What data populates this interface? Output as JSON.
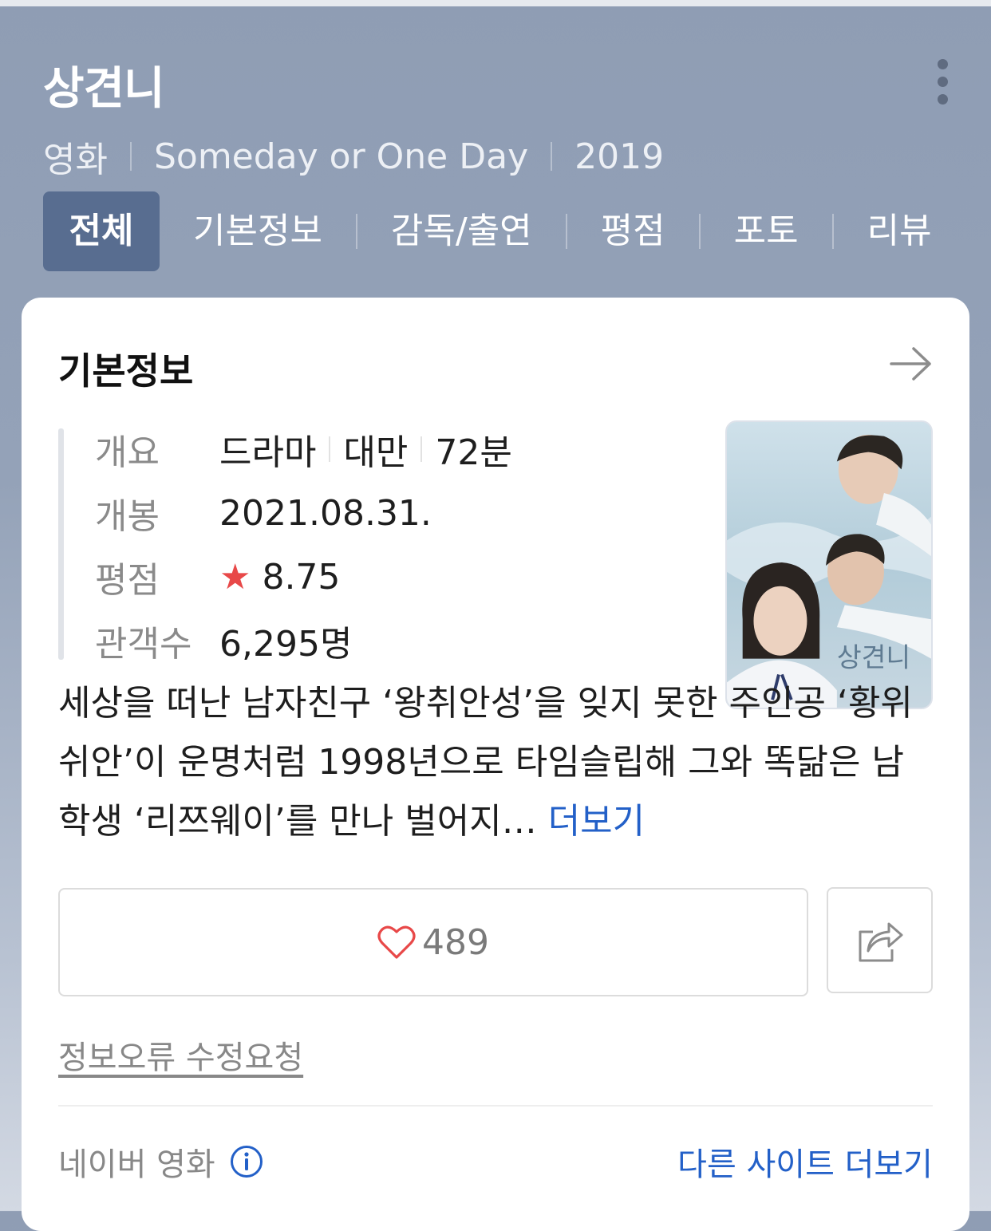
{
  "header": {
    "title": "상견니",
    "meta": [
      "영화",
      "Someday or One Day",
      "2019"
    ]
  },
  "tabs": [
    {
      "label": "전체",
      "active": true
    },
    {
      "label": "기본정보"
    },
    {
      "label": "감독/출연"
    },
    {
      "label": "평점"
    },
    {
      "label": "포토"
    },
    {
      "label": "리뷰"
    }
  ],
  "card": {
    "title": "기본정보",
    "rows": {
      "overview_label": "개요",
      "genre": "드라마",
      "country": "대만",
      "runtime": "72분",
      "release_label": "개봉",
      "release_date": "2021.08.31.",
      "rating_label": "평점",
      "rating_value": "8.75",
      "audience_label": "관객수",
      "audience_value": "6,295명"
    },
    "poster": {
      "title_text": "상견니"
    },
    "description": "세상을 떠난 남자친구 ‘왕취안성’을 잊지 못한 주인공 ‘황위쉬안’이 운명처럼 1998년으로 타임슬립해 그와 똑닮은 남학생 ‘리쯔웨이’를 만나 벌어지…",
    "description_more": "더보기",
    "like_count": "489",
    "report_link": "정보오류 수정요청",
    "source": "네이버 영화",
    "other_sites": "다른 사이트 더보기"
  },
  "colors": {
    "header_bg": "#93a1b7",
    "active_tab": "#586d90",
    "link_blue": "#2360c8",
    "star_red": "#e84848"
  },
  "icons": [
    "more-vertical-icon",
    "arrow-right-icon",
    "star-icon",
    "heart-icon",
    "share-icon",
    "info-icon"
  ]
}
